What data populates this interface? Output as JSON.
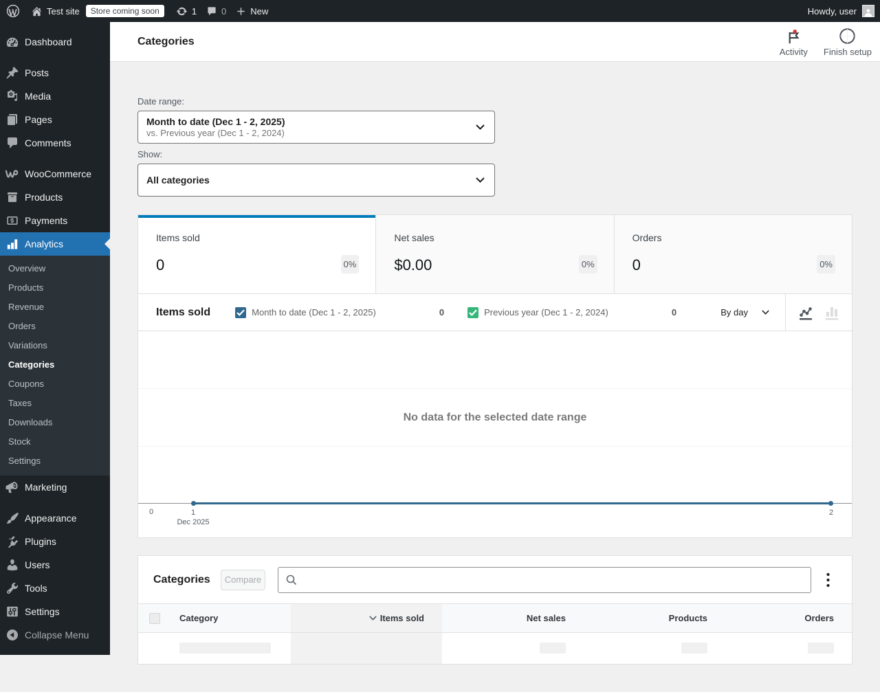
{
  "admin_bar": {
    "site_name": "Test site",
    "coming_soon_badge": "Store coming soon",
    "updates_count": "1",
    "comments_count": "0",
    "new_label": "New",
    "howdy": "Howdy, user"
  },
  "sidebar": {
    "items": [
      {
        "label": "Dashboard",
        "icon": "dashboard",
        "separator_after": true
      },
      {
        "label": "Posts",
        "icon": "post"
      },
      {
        "label": "Media",
        "icon": "media"
      },
      {
        "label": "Pages",
        "icon": "page"
      },
      {
        "label": "Comments",
        "icon": "comments",
        "separator_after": true
      },
      {
        "label": "WooCommerce",
        "icon": "woocommerce"
      },
      {
        "label": "Products",
        "icon": "products"
      },
      {
        "label": "Payments",
        "icon": "payments"
      },
      {
        "label": "Analytics",
        "icon": "analytics",
        "active": true,
        "submenu": [
          "Overview",
          "Products",
          "Revenue",
          "Orders",
          "Variations",
          "Categories",
          "Coupons",
          "Taxes",
          "Downloads",
          "Stock",
          "Settings"
        ],
        "current_submenu": "Categories"
      },
      {
        "label": "Marketing",
        "icon": "marketing",
        "separator_after": true
      },
      {
        "label": "Appearance",
        "icon": "appearance"
      },
      {
        "label": "Plugins",
        "icon": "plugins"
      },
      {
        "label": "Users",
        "icon": "users"
      },
      {
        "label": "Tools",
        "icon": "tools"
      },
      {
        "label": "Settings",
        "icon": "settings"
      },
      {
        "label": "Collapse Menu",
        "icon": "collapse",
        "collapse": true
      }
    ]
  },
  "header": {
    "title": "Categories",
    "activity_label": "Activity",
    "finish_setup_label": "Finish setup"
  },
  "filters": {
    "date_range_label": "Date range:",
    "date_range_value": "Month to date (Dec 1 - 2, 2025)",
    "date_range_compare": "vs. Previous year (Dec 1 - 2, 2024)",
    "show_label": "Show:",
    "show_value": "All categories"
  },
  "summary": [
    {
      "label": "Items sold",
      "value": "0",
      "delta": "0%",
      "selected": true
    },
    {
      "label": "Net sales",
      "value": "$0.00",
      "delta": "0%",
      "selected": false
    },
    {
      "label": "Orders",
      "value": "0",
      "delta": "0%",
      "selected": false
    }
  ],
  "chart": {
    "title": "Items sold",
    "interval_label": "By day",
    "empty_message": "No data for the selected date range",
    "accent_blue": "#31688E",
    "accent_green": "#35B779"
  },
  "chart_data": {
    "type": "line",
    "title": "Items sold",
    "x": [
      "Dec 1 2025",
      "Dec 2 2025"
    ],
    "series": [
      {
        "name": "Month to date (Dec 1 - 2, 2025)",
        "values": [
          0,
          0
        ],
        "color": "#31688E",
        "total": "0",
        "checked": true
      },
      {
        "name": "Previous year (Dec 1 - 2, 2024)",
        "values": [
          0,
          0
        ],
        "color": "#35B779",
        "total": "0",
        "checked": true
      }
    ],
    "xticks": [
      {
        "label": "1",
        "sublabel": "Dec 2025"
      },
      {
        "label": "2",
        "sublabel": ""
      }
    ],
    "yticks": [
      "0"
    ],
    "ylim": [
      0,
      1
    ],
    "grid": true,
    "legend_position": "top",
    "empty_message": "No data for the selected date range"
  },
  "table": {
    "title": "Categories",
    "compare_label": "Compare",
    "search_placeholder": "",
    "columns": [
      {
        "label": "Category",
        "key": "category"
      },
      {
        "label": "Items sold",
        "key": "items_sold",
        "sorted": "desc"
      },
      {
        "label": "Net sales",
        "key": "net_sales"
      },
      {
        "label": "Products",
        "key": "products"
      },
      {
        "label": "Orders",
        "key": "orders"
      }
    ],
    "rows_loading": 1
  }
}
